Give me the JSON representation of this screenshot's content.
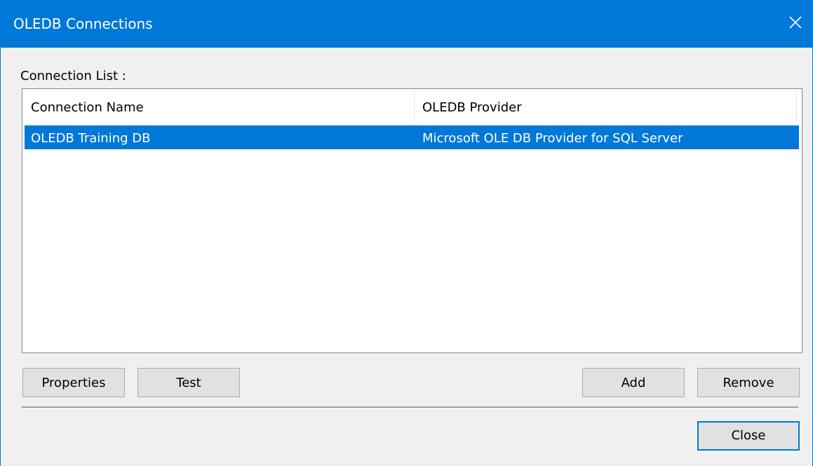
{
  "window": {
    "title": "OLEDB Connections",
    "close_icon": "close-icon"
  },
  "connection_list": {
    "label": "Connection List :",
    "columns": [
      "Connection Name",
      "OLEDB Provider"
    ],
    "rows": [
      {
        "name": "OLEDB Training DB",
        "provider": "Microsoft OLE DB Provider for SQL Server",
        "selected": true
      }
    ]
  },
  "buttons": {
    "properties": "Properties",
    "test": "Test",
    "add": "Add",
    "remove": "Remove",
    "close": "Close"
  },
  "colors": {
    "accent": "#0078d7",
    "selection_text": "#ffffff",
    "dialog_background": "#f0f0f0"
  }
}
